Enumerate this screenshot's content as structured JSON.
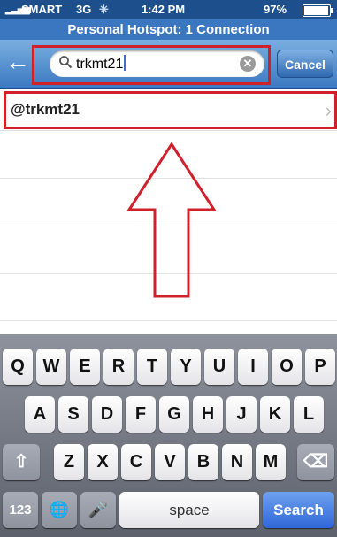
{
  "status_bar": {
    "signal": "▂▃▅▆",
    "carrier": "SMART",
    "network": "3G",
    "activity": "✳",
    "time": "1:42 PM",
    "battery": "97%"
  },
  "hotspot": {
    "text": "Personal Hotspot: 1 Connection"
  },
  "search": {
    "back_icon": "←",
    "glass_icon": "🔍",
    "query": "trkmt21",
    "clear_icon": "✕",
    "cancel_label": "Cancel"
  },
  "results": [
    {
      "label": "@trkmt21",
      "chevron": "›"
    }
  ],
  "keyboard": {
    "row1": [
      "Q",
      "W",
      "E",
      "R",
      "T",
      "Y",
      "U",
      "I",
      "O",
      "P"
    ],
    "row2": [
      "A",
      "S",
      "D",
      "F",
      "G",
      "H",
      "J",
      "K",
      "L"
    ],
    "row3": [
      "Z",
      "X",
      "C",
      "V",
      "B",
      "N",
      "M"
    ],
    "shift_icon": "⇧",
    "delete_icon": "⌫",
    "numbers_label": "123",
    "globe_icon": "🌐",
    "mic_icon": "🎤",
    "space_label": "space",
    "search_label": "Search"
  },
  "colors": {
    "annotation": "#d0202a",
    "accent": "#3b77c0"
  }
}
